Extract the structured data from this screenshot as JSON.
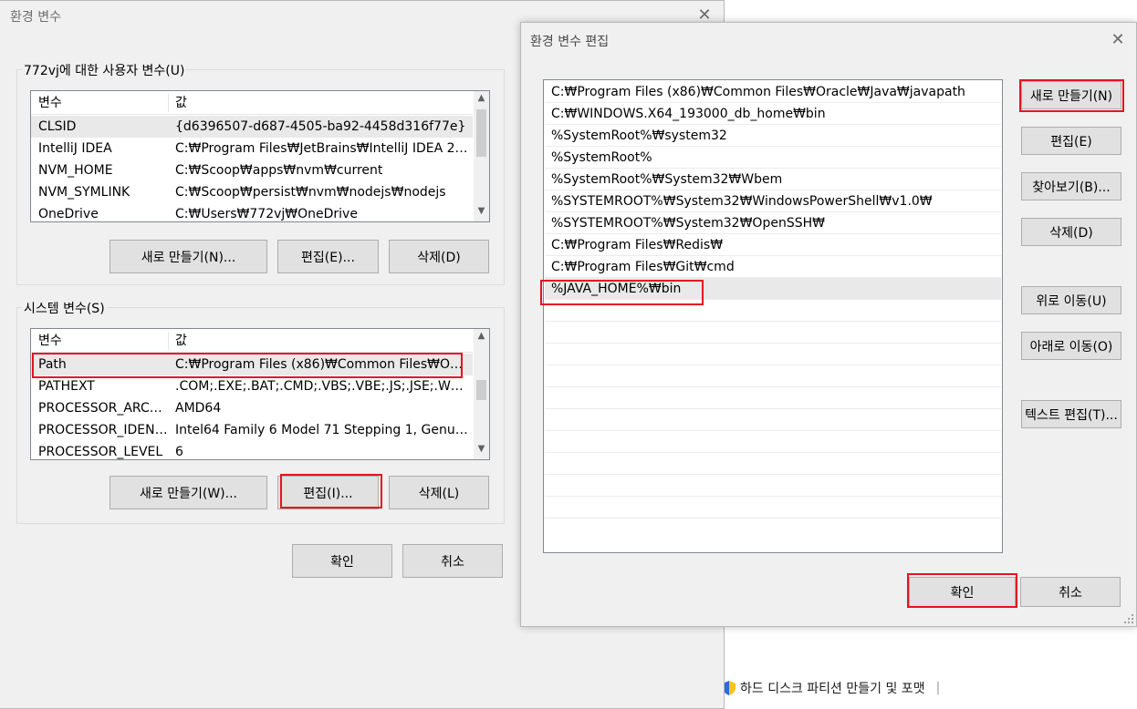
{
  "main_dialog": {
    "title": "환경 변수",
    "user_vars": {
      "group_label": "772vj에 대한 사용자 변수(U)",
      "col_name": "변수",
      "col_value": "값",
      "rows": [
        {
          "name": "CLSID",
          "value": "{d6396507-d687-4505-ba92-4458d316f77e}"
        },
        {
          "name": "IntelliJ IDEA",
          "value": "C:₩Program Files₩JetBrains₩IntelliJ IDEA 202..."
        },
        {
          "name": "NVM_HOME",
          "value": "C:₩Scoop₩apps₩nvm₩current"
        },
        {
          "name": "NVM_SYMLINK",
          "value": "C:₩Scoop₩persist₩nvm₩nodejs₩nodejs"
        },
        {
          "name": "OneDrive",
          "value": "C:₩Users₩772vj₩OneDrive"
        }
      ],
      "btn_new": "새로 만들기(N)...",
      "btn_edit": "편집(E)...",
      "btn_delete": "삭제(D)"
    },
    "system_vars": {
      "group_label": "시스템 변수(S)",
      "col_name": "변수",
      "col_value": "값",
      "rows": [
        {
          "name": "Path",
          "value": "C:₩Program Files (x86)₩Common Files₩Orac..."
        },
        {
          "name": "PATHEXT",
          "value": ".COM;.EXE;.BAT;.CMD;.VBS;.VBE;.JS;.JSE;.WSF;..."
        },
        {
          "name": "PROCESSOR_ARCH...",
          "value": "AMD64"
        },
        {
          "name": "PROCESSOR_IDENT...",
          "value": "Intel64 Family 6 Model 71 Stepping 1, Genui..."
        },
        {
          "name": "PROCESSOR_LEVEL",
          "value": "6"
        }
      ],
      "btn_new": "새로 만들기(W)...",
      "btn_edit": "편집(I)...",
      "btn_delete": "삭제(L)"
    },
    "btn_ok": "확인",
    "btn_cancel": "취소"
  },
  "edit_dialog": {
    "title": "환경 변수 편집",
    "entries": [
      "C:₩Program Files (x86)₩Common Files₩Oracle₩Java₩javapath",
      "C:₩WINDOWS.X64_193000_db_home₩bin",
      "%SystemRoot%₩system32",
      "%SystemRoot%",
      "%SystemRoot%₩System32₩Wbem",
      "%SYSTEMROOT%₩System32₩WindowsPowerShell₩v1.0₩",
      "%SYSTEMROOT%₩System32₩OpenSSH₩",
      "C:₩Program Files₩Redis₩",
      "C:₩Program Files₩Git₩cmd",
      "%JAVA_HOME%₩bin"
    ],
    "btn_new": "새로 만들기(N)",
    "btn_edit": "편집(E)",
    "btn_browse": "찾아보기(B)...",
    "btn_delete": "삭제(D)",
    "btn_move_up": "위로 이동(U)",
    "btn_move_down": "아래로 이동(O)",
    "btn_edit_text": "텍스트 편집(T)...",
    "btn_ok": "확인",
    "btn_cancel": "취소"
  },
  "background": {
    "link_disk": "하드 디스크 파티션 만들기 및 포맷",
    "link_separator": "|"
  },
  "colors": {
    "highlight_border": "#e81123",
    "selected_row": "#e9e9e9",
    "dialog_bg": "#f0f0f0",
    "button_bg": "#e1e1e1"
  }
}
